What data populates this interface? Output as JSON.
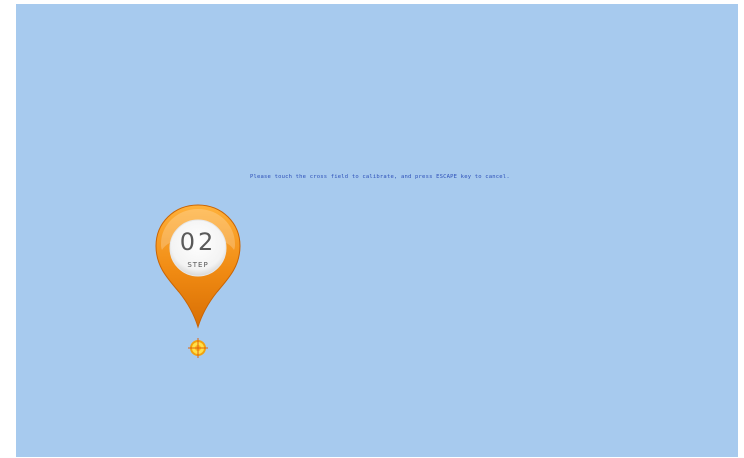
{
  "instruction": {
    "text": "Please touch the cross field to calibrate, and press ESCAPE key to cancel."
  },
  "marker": {
    "step_number": "02",
    "step_label": "STEP",
    "color": "#f08a12"
  },
  "target": {
    "icon": "crosshair-target-icon",
    "color": "#f2a20e"
  },
  "background_color": "#a7caee"
}
